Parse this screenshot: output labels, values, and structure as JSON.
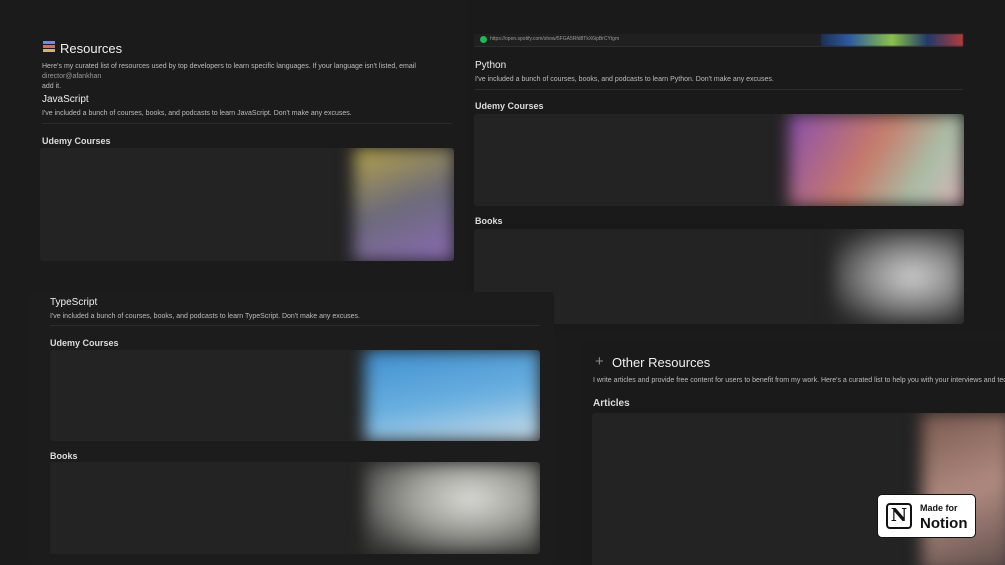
{
  "resources": {
    "title": "Resources",
    "icon": "books-icon",
    "description": "Here's my curated list of resources used by top developers to learn specific languages. If your language isn't listed, email",
    "email": "director@afankhan",
    "description_end": "add it."
  },
  "javascript": {
    "title": "JavaScript",
    "description": "I've included a bunch of courses, books, and podcasts to learn JavaScript. Don't make any excuses.",
    "udemy_label": "Udemy Courses"
  },
  "python": {
    "url": "https://open.spotify.com/show/5FGA5Rfd8TkX6ipBrCYtgm",
    "title": "Python",
    "description": "I've included a bunch of courses, books, and podcasts to learn Python. Don't make any excuses.",
    "udemy_label": "Udemy Courses",
    "books_label": "Books"
  },
  "typescript": {
    "title": "TypeScript",
    "description": "I've included a bunch of courses, books, and podcasts to learn TypeScript. Don't make any excuses.",
    "udemy_label": "Udemy Courses",
    "books_label": "Books"
  },
  "other": {
    "title": "Other Resources",
    "icon": "plus-icon",
    "description": "I write articles and provide free content for users to benefit from my work. Here's a curated list to help you with your interviews and tech care",
    "articles_label": "Articles"
  },
  "badge": {
    "made_for": "Made for",
    "brand": "Notion",
    "logo_letter": "N"
  },
  "colors": {
    "background": "#1b1b1c",
    "panel": "#191919",
    "card": "#232323",
    "spotify": "#1db954"
  }
}
